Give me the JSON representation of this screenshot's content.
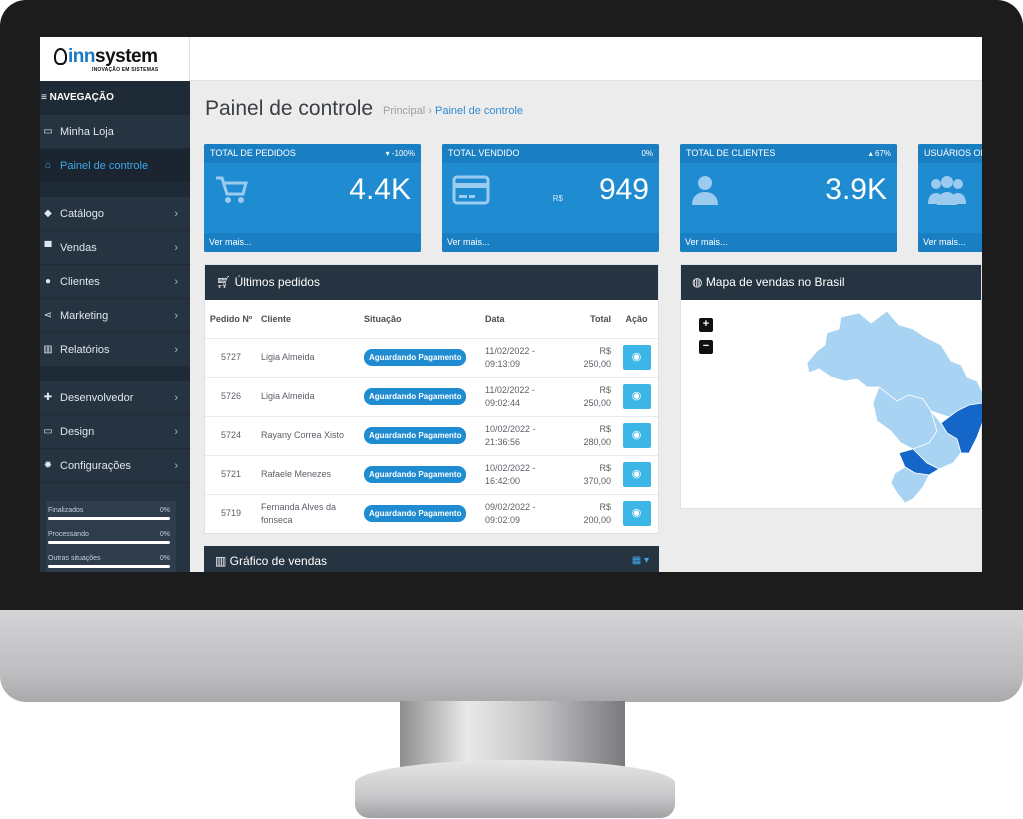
{
  "brand": {
    "logo_text_inn": "inn",
    "logo_text_system": "system",
    "tagline": "INOVAÇÃO EM SISTEMAS"
  },
  "sidebar": {
    "title": "≡ NAVEGAÇÃO",
    "items": [
      {
        "label": "Minha Loja",
        "icon": "monitor-icon"
      },
      {
        "label": "Painel de controle",
        "icon": "home-icon"
      },
      {
        "label": "Catálogo",
        "icon": "tag-icon"
      },
      {
        "label": "Vendas",
        "icon": "cart-icon"
      },
      {
        "label": "Clientes",
        "icon": "user-icon"
      },
      {
        "label": "Marketing",
        "icon": "share-icon"
      },
      {
        "label": "Relatórios",
        "icon": "bar-chart-icon"
      },
      {
        "label": "Desenvolvedor",
        "icon": "puzzle-icon"
      },
      {
        "label": "Design",
        "icon": "monitor-icon"
      },
      {
        "label": "Configurações",
        "icon": "gear-icon"
      }
    ],
    "status": [
      {
        "label": "Finalizados",
        "percent": "0%"
      },
      {
        "label": "Processando",
        "percent": "0%"
      },
      {
        "label": "Outras situações",
        "percent": "0%"
      }
    ]
  },
  "page": {
    "title": "Painel de controle",
    "breadcrumb_home": "Principal",
    "breadcrumb_current": "Painel de controle"
  },
  "cards": [
    {
      "title": "TOTAL DE PEDIDOS",
      "trend": "▾ -100%",
      "value": "4.4K",
      "footer": "Ver mais...",
      "icon": "cart-icon"
    },
    {
      "title": "TOTAL VENDIDO",
      "trend": "0%",
      "currency": "R$",
      "value": "949",
      "footer": "Ver mais...",
      "icon": "credit-card-icon"
    },
    {
      "title": "TOTAL DE CLIENTES",
      "trend": "▴ 67%",
      "value": "3.9K",
      "footer": "Ver mais...",
      "icon": "user-icon"
    },
    {
      "title": "USUÁRIOS ON",
      "trend": "",
      "value": "",
      "footer": "Ver mais...",
      "icon": "users-icon"
    }
  ],
  "orders": {
    "title": "Últimos pedidos",
    "columns": {
      "id": "Pedido Nº",
      "client": "Cliente",
      "status": "Situação",
      "date": "Data",
      "total": "Total",
      "action": "Ação"
    },
    "rows": [
      {
        "id": "5727",
        "client": "Ligia Almeida",
        "status": "Aguardando Pagamento",
        "date": "11/02/2022 - 09:13:09",
        "currency": "R$",
        "amount": "250,00"
      },
      {
        "id": "5726",
        "client": "Ligia Almeida",
        "status": "Aguardando Pagamento",
        "date": "11/02/2022 - 09:02:44",
        "currency": "R$",
        "amount": "250,00"
      },
      {
        "id": "5724",
        "client": "Rayany Correa Xisto",
        "status": "Aguardando Pagamento",
        "date": "10/02/2022 - 21:36:56",
        "currency": "R$",
        "amount": "280,00"
      },
      {
        "id": "5721",
        "client": "Rafaele Menezes",
        "status": "Aguardando Pagamento",
        "date": "10/02/2022 - 16:42:00",
        "currency": "R$",
        "amount": "370,00"
      },
      {
        "id": "5719",
        "client": "Fernanda Alves da fonseca",
        "status": "Aguardando Pagamento",
        "date": "09/02/2022 - 09:02:09",
        "currency": "R$",
        "amount": "200,00"
      }
    ]
  },
  "map": {
    "title": "Mapa de vendas no Brasil",
    "zoom_in": "+",
    "zoom_out": "−",
    "base_color": "#a9d3f3",
    "highlight_color": "#1466c8"
  },
  "sales_chart": {
    "title": "Gráfico de vendas",
    "calendar_icon": "calendar-icon"
  },
  "colors": {
    "sidebar_bg": "#263341",
    "card_blue": "#1f8bd1",
    "accent": "#3fa7ea",
    "action_button": "#3cb6e7"
  }
}
